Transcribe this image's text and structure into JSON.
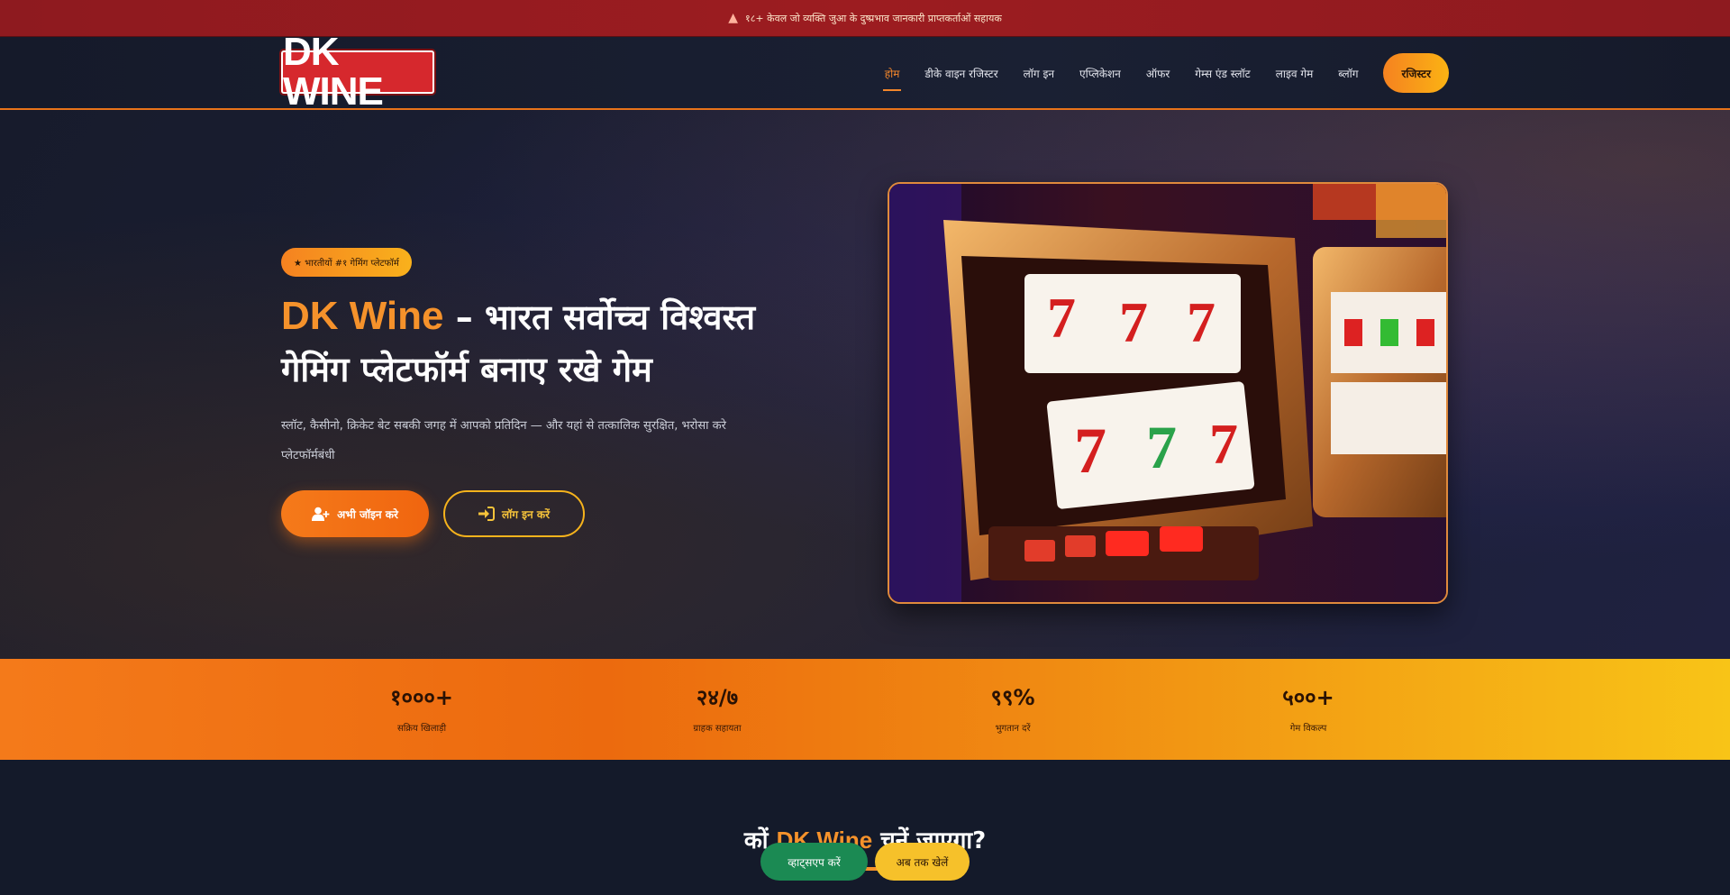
{
  "topbar": {
    "text": "१८+ केवल जो व्यक्ति जुआ के दुष्प्रभाव जानकारी प्राप्तकर्ताओं सहायक"
  },
  "nav": {
    "logo": "DK WINE",
    "items": [
      "होम",
      "डीके वाइन रजिस्टर",
      "लॉग इन",
      "एप्लिकेशन",
      "ऑफर",
      "गेम्स एंड स्लॉट",
      "लाइव गेम",
      "ब्लॉग"
    ],
    "cta": "रजिस्टर"
  },
  "hero": {
    "badge": "★ भारतीयों #१ गेमिंग प्लेटफॉर्म",
    "title_brand": "DK Wine",
    "title_rest": " – भारत सर्वोच्च विश्वस्त गेमिंग प्लेटफॉर्म बनाए रखे गेम",
    "description": "स्लॉट, कैसीनो, क्रिकेट बेट सबकी जगह में आपको प्रतिदिन — और यहां से तत्कालिक सुरक्षित, भरोसा करे प्लेटफॉर्मबंधी",
    "primary_button": "अभी जॉइन करे",
    "secondary_button": "लॉग इन करें"
  },
  "stats": [
    {
      "value": "१०००+",
      "label": "सक्रिय खिलाड़ी"
    },
    {
      "value": "२४/७",
      "label": "ग्राहक सहायता"
    },
    {
      "value": "९९%",
      "label": "भुगतान दरें"
    },
    {
      "value": "५००+",
      "label": "गेम विकल्प"
    }
  ],
  "why": {
    "title_prefix": "कों ",
    "title_brand": "DK Wine",
    "title_suffix": " चुनें जाएगा?"
  },
  "floating": {
    "green": "व्हाट्सएप करें",
    "yellow": "अब तक खेलें"
  }
}
